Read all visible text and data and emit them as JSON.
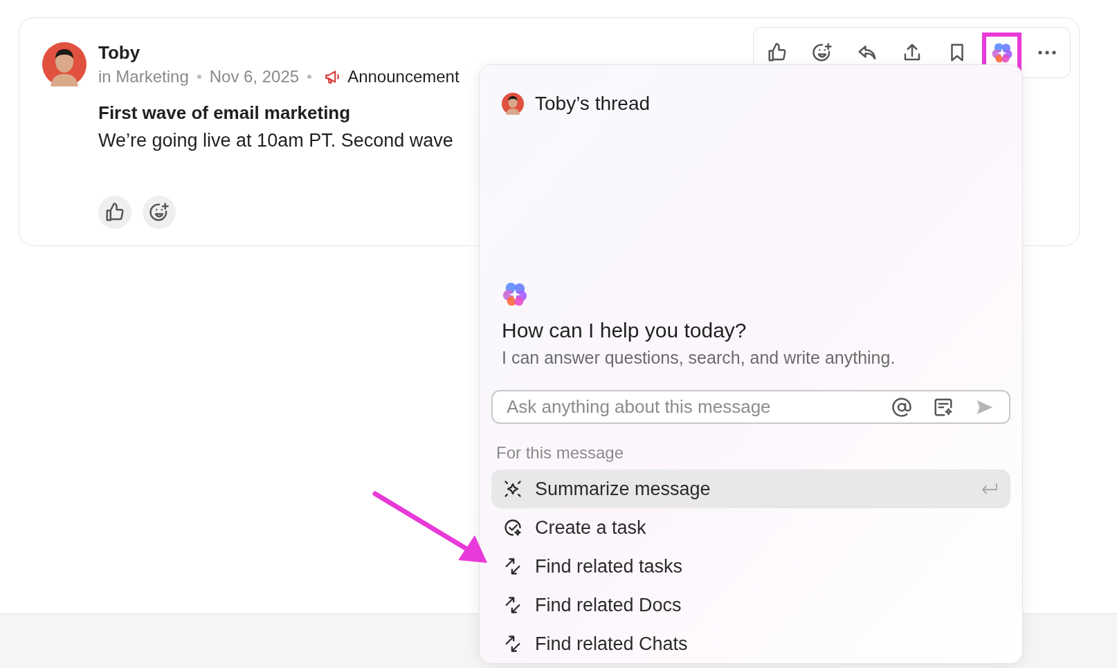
{
  "post": {
    "author": "Toby",
    "channel": "in Marketing",
    "date": "Nov 6, 2025",
    "tag": "Announcement",
    "title": "First wave of email marketing",
    "body": "We’re going live at 10am PT. Second wave"
  },
  "toolbar_actions": [
    {
      "kind": "like",
      "highlighted": false
    },
    {
      "kind": "emoji",
      "highlighted": false
    },
    {
      "kind": "reply",
      "highlighted": false
    },
    {
      "kind": "share",
      "highlighted": false
    },
    {
      "kind": "bookmark",
      "highlighted": false
    },
    {
      "kind": "ai",
      "highlighted": true
    },
    {
      "kind": "more",
      "highlighted": false
    }
  ],
  "assistant": {
    "thread_title": "Toby’s thread",
    "heading": "How can I help you today?",
    "subheading": "I can answer questions, search, and write anything.",
    "input": {
      "placeholder": "Ask anything about this message"
    },
    "section_label": "For this message",
    "actions": [
      {
        "label": "Summarize message",
        "kind": "summarize",
        "selected": true
      },
      {
        "label": "Create a task",
        "kind": "task",
        "selected": false
      },
      {
        "label": "Find related tasks",
        "kind": "related",
        "selected": false
      },
      {
        "label": "Find related Docs",
        "kind": "related",
        "selected": false
      },
      {
        "label": "Find related Chats",
        "kind": "related",
        "selected": false
      }
    ]
  }
}
